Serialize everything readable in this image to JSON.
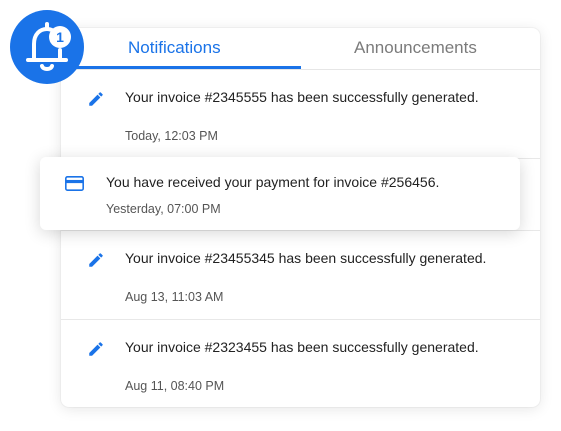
{
  "tabs": {
    "notifications": "Notifications",
    "announcements": "Announcements",
    "active": "Notifications"
  },
  "badge": {
    "count": "1",
    "icon": "bell-icon"
  },
  "notifications": [
    {
      "icon": "pencil-icon",
      "message": "Your invoice #2345555 has been successfully generated.",
      "time": "Today, 12:03 PM"
    },
    {
      "icon": "credit-card-icon",
      "message": "You have received your payment for invoice #256456.",
      "time": "Yesterday, 07:00 PM",
      "highlighted": true
    },
    {
      "icon": "pencil-icon",
      "message": "Your invoice #23455345 has been successfully generated.",
      "time": "Aug 13, 11:03 AM"
    },
    {
      "icon": "pencil-icon",
      "message": "Your invoice #2323455 has been successfully generated.",
      "time": "Aug 11, 08:40 PM"
    }
  ],
  "colors": {
    "accent": "#1a73e8",
    "inactive_tab": "#7b7b7b",
    "badge_bg": "#1a73e8"
  }
}
